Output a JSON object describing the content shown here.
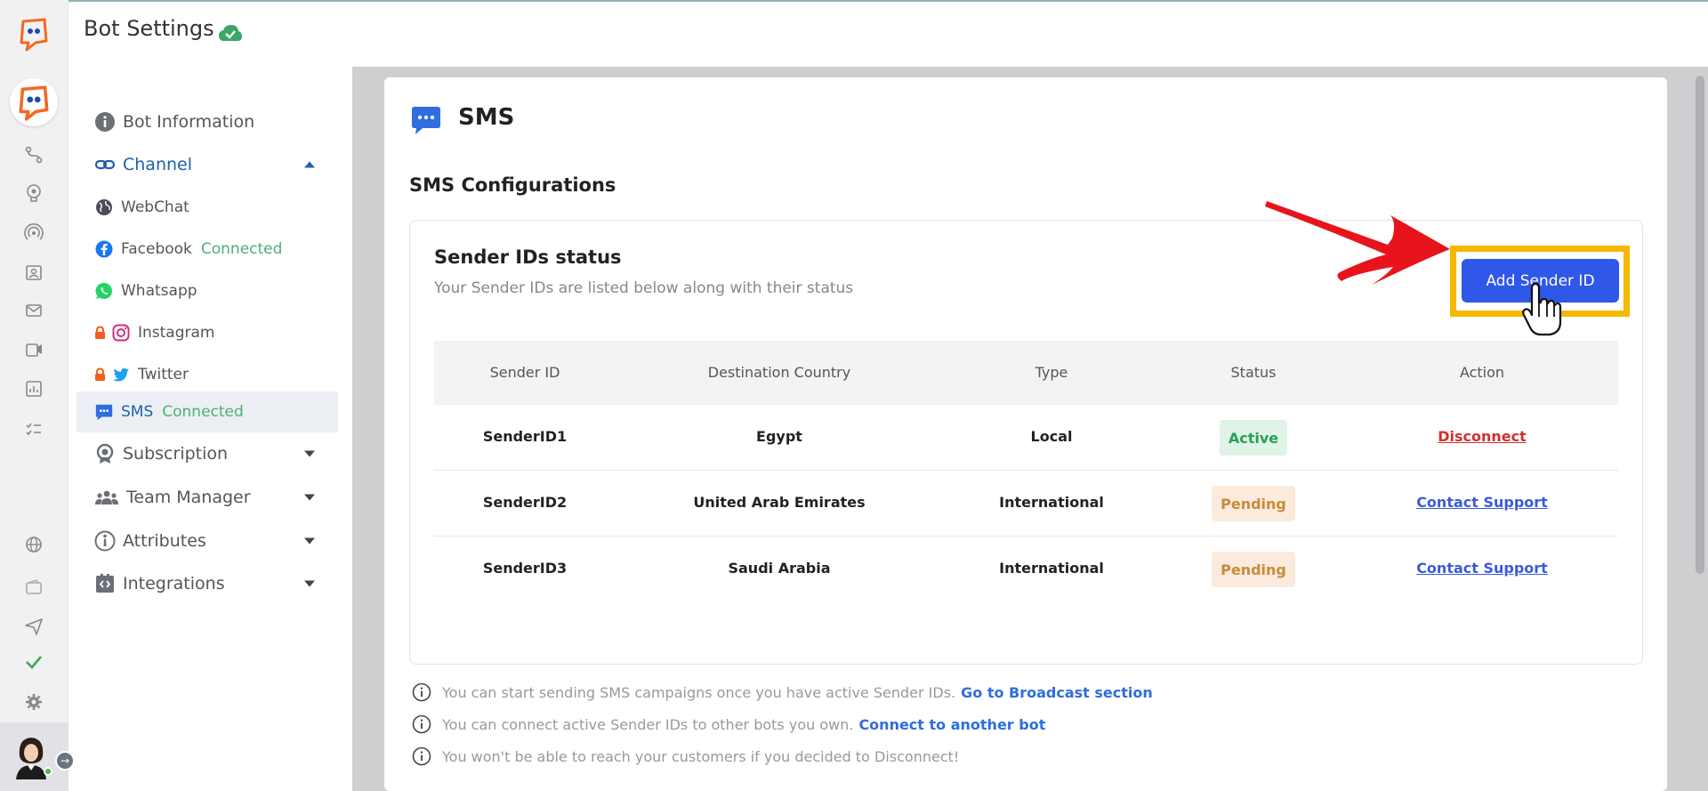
{
  "header": {
    "title": "Bot Settings"
  },
  "nav": {
    "bot_information": "Bot Information",
    "channel": "Channel",
    "webchat": "WebChat",
    "facebook": "Facebook",
    "facebook_status": "Connected",
    "whatsapp": "Whatsapp",
    "instagram": "Instagram",
    "twitter": "Twitter",
    "sms": "SMS",
    "sms_status": "Connected",
    "subscription": "Subscription",
    "team_manager": "Team Manager",
    "attributes": "Attributes",
    "integrations": "Integrations"
  },
  "main": {
    "title": "SMS",
    "section_title": "SMS Configurations",
    "status_title": "Sender IDs status",
    "status_subtitle": "Your Sender IDs are listed below along with their status",
    "add_button": "Add Sender ID",
    "columns": [
      "Sender ID",
      "Destination Country",
      "Type",
      "Status",
      "Action"
    ],
    "rows": [
      {
        "sender_id": "SenderID1",
        "country": "Egypt",
        "type": "Local",
        "status": "Active",
        "action": "Disconnect"
      },
      {
        "sender_id": "SenderID2",
        "country": "United Arab Emirates",
        "type": "International",
        "status": "Pending",
        "action": "Contact Support"
      },
      {
        "sender_id": "SenderID3",
        "country": "Saudi Arabia",
        "type": "International",
        "status": "Pending",
        "action": "Contact Support"
      }
    ],
    "notes": [
      {
        "text": "You can start sending SMS campaigns once you have active Sender IDs.",
        "link": "Go to Broadcast section"
      },
      {
        "text": "You can connect active Sender IDs to other bots you own.",
        "link": "Connect to another bot"
      },
      {
        "text": "You won't be able to reach your customers if you decided to Disconnect!",
        "link": ""
      }
    ]
  },
  "colors": {
    "primary": "#2f57e8",
    "accent_blue": "#1f5fa8",
    "connected_green": "#4caf7a",
    "highlight": "#f5b800",
    "arrow_red": "#e8141c"
  }
}
